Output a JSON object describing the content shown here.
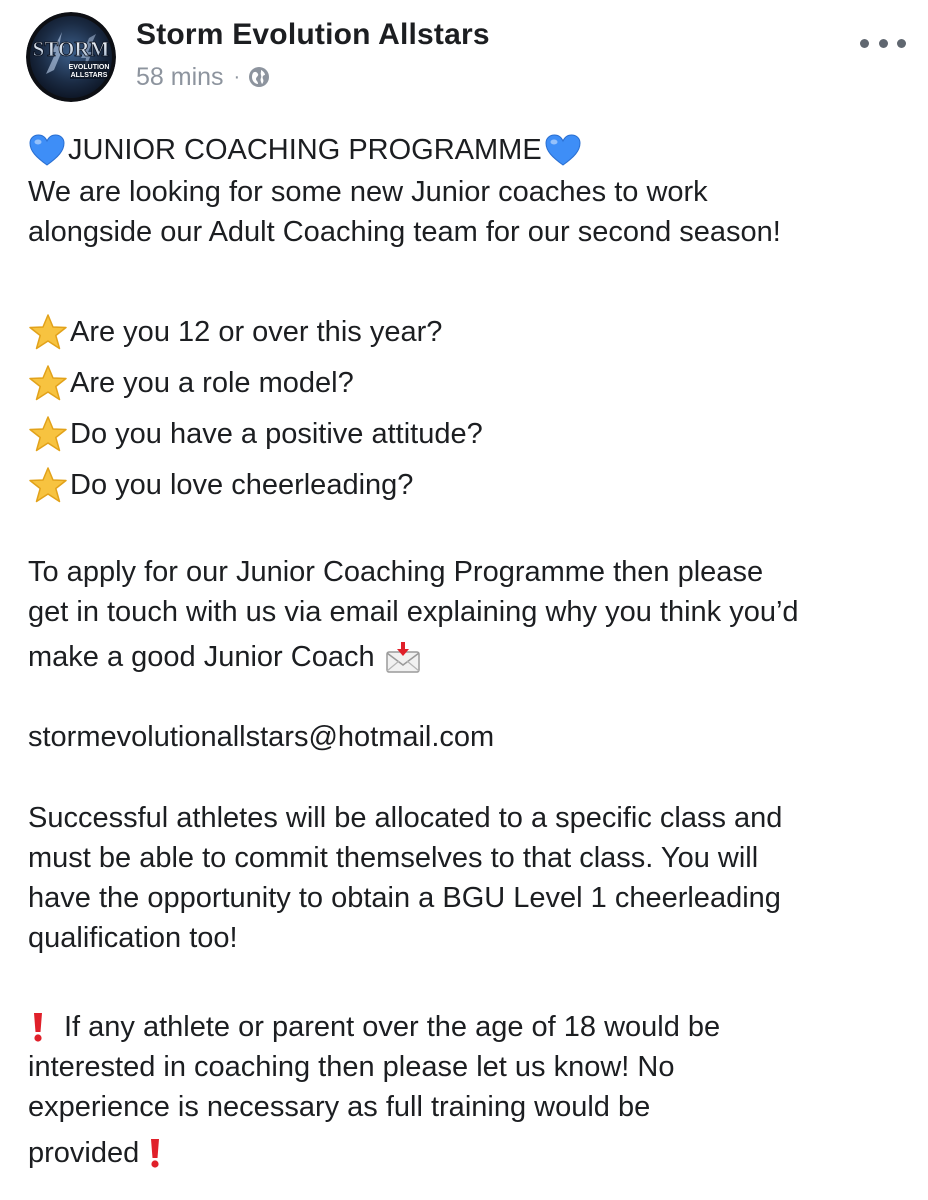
{
  "post": {
    "page_name": "Storm Evolution Allstars",
    "timestamp": "58 mins",
    "separator": "·",
    "privacy_icon": "globe-icon",
    "more_icon": "more-options-icon",
    "avatar": {
      "logo_text_main": "STORM",
      "logo_text_sub1": "EVOLUTION",
      "logo_text_sub2": "ALLSTARS"
    },
    "heading": {
      "icon_left": "blue-heart-emoji",
      "text": "JUNIOR COACHING PROGRAMME",
      "icon_right": "blue-heart-emoji"
    },
    "intro_lines": [
      "We are looking for some new Junior coaches to work",
      "alongside our Adult Coaching team for our second season!"
    ],
    "questions": [
      {
        "icon": "star-emoji",
        "text": "Are you 12 or over this year?"
      },
      {
        "icon": "star-emoji",
        "text": "Are you a role model?"
      },
      {
        "icon": "star-emoji",
        "text": "Do you have a positive attitude?"
      },
      {
        "icon": "star-emoji",
        "text": "Do you love cheerleading?"
      }
    ],
    "apply_lines": [
      "To apply for our Junior Coaching Programme then please",
      "get in touch with us via email explaining why you think you’d",
      "make a good Junior Coach"
    ],
    "apply_icon": "incoming-envelope-emoji",
    "email": "stormevolutionallstars@hotmail.com",
    "success_lines": [
      "Successful athletes will be allocated to a specific class and",
      "must be able to commit themselves to that class. You will",
      "have the opportunity to obtain a BGU Level 1 cheerleading",
      "qualification too!"
    ],
    "adult_lines": [
      "If any athlete or parent over the age of 18 would be",
      "interested in coaching then please let us know! No",
      "experience is necessary as full training would be",
      "provided"
    ],
    "adult_icon": "red-exclamation-emoji"
  },
  "colors": {
    "text": "#1c1e21",
    "meta": "#8d949e",
    "heart_blue": "#3e8ef7",
    "star_yellow": "#f7c340",
    "exclaim_red": "#e0202a"
  }
}
